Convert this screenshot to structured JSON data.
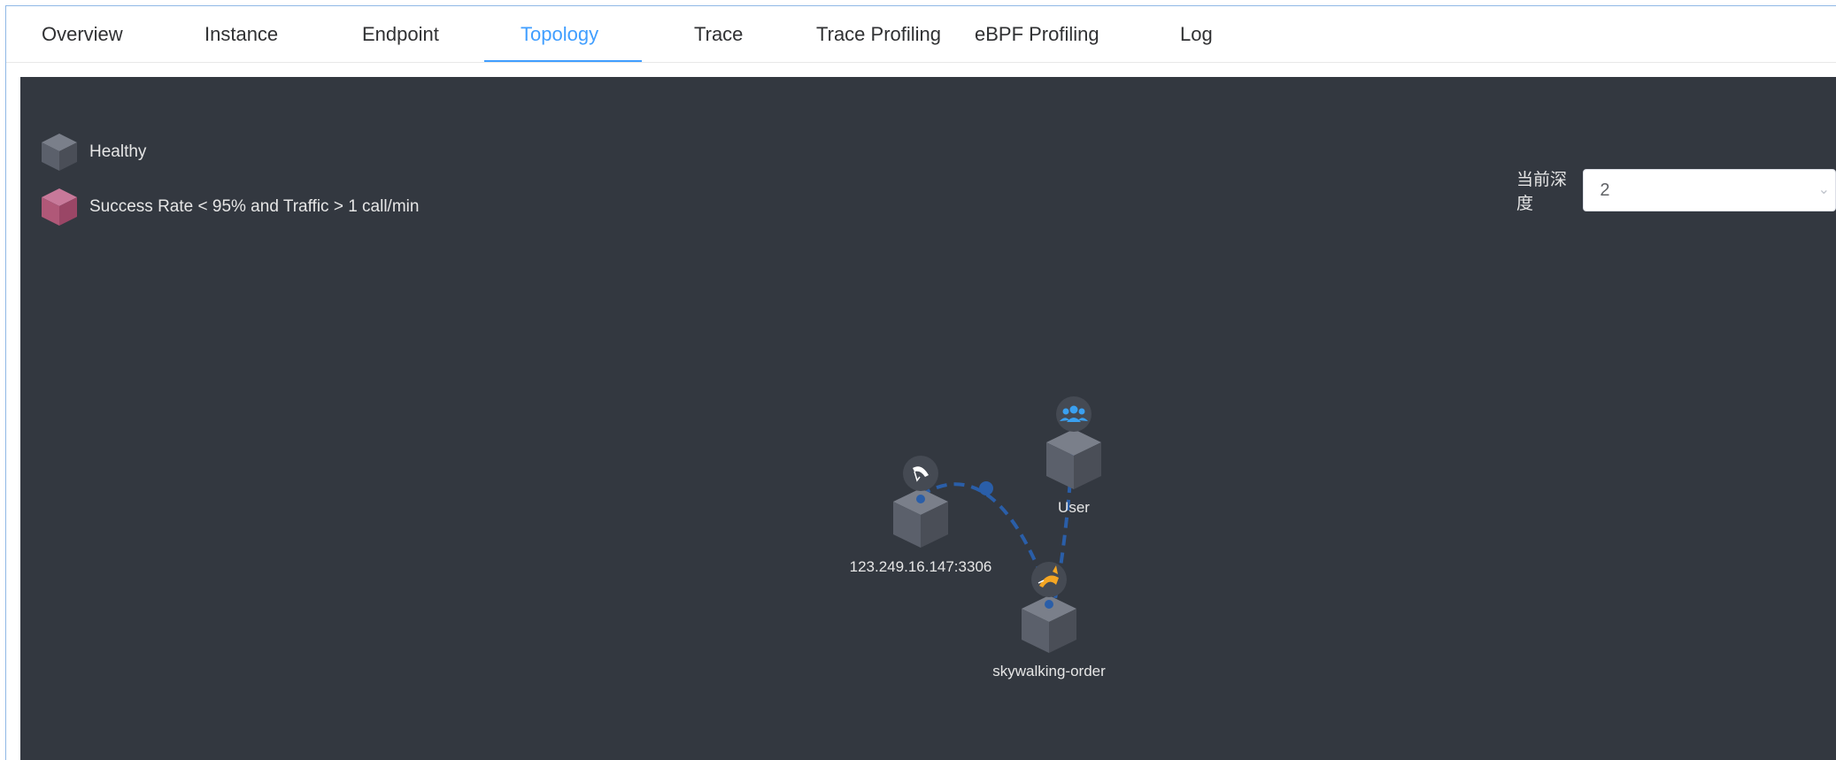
{
  "tabs": [
    {
      "label": "Overview",
      "active": false
    },
    {
      "label": "Instance",
      "active": false
    },
    {
      "label": "Endpoint",
      "active": false
    },
    {
      "label": "Topology",
      "active": true
    },
    {
      "label": "Trace",
      "active": false
    },
    {
      "label": "Trace Profiling",
      "active": false
    },
    {
      "label": "eBPF Profiling",
      "active": false
    },
    {
      "label": "Log",
      "active": false
    }
  ],
  "legend": {
    "healthy": "Healthy",
    "unhealthy": "Success Rate < 95% and Traffic > 1 call/min"
  },
  "depth": {
    "label": "当前深度",
    "value": "2"
  },
  "topology": {
    "nodes": [
      {
        "id": "mysql",
        "label": "123.249.16.147:3306",
        "icon": "mysql-dolphin-icon"
      },
      {
        "id": "user",
        "label": "User",
        "icon": "users-icon"
      },
      {
        "id": "order",
        "label": "skywalking-order",
        "icon": "tomcat-icon"
      }
    ]
  },
  "colors": {
    "canvas_bg": "#333840",
    "accent": "#409eff",
    "healthy_cube": "#5b606b",
    "unhealthy_cube": "#b05878",
    "link": "#2a5ea8"
  }
}
